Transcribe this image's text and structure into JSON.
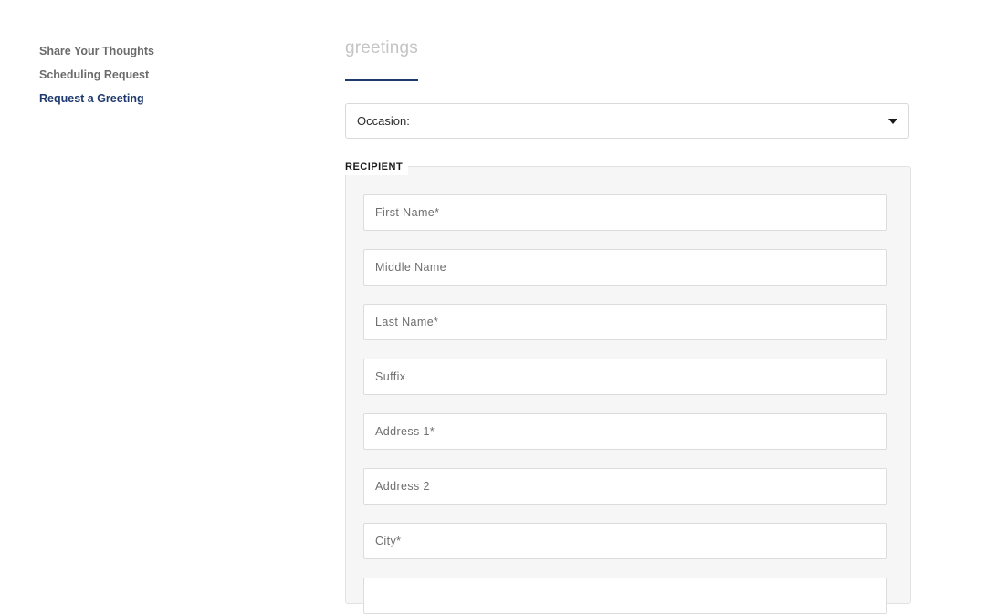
{
  "sidebar": {
    "items": [
      {
        "label": "Share Your Thoughts",
        "active": false
      },
      {
        "label": "Scheduling Request",
        "active": false
      },
      {
        "label": "Request a Greeting",
        "active": true
      }
    ]
  },
  "main": {
    "title": "greetings",
    "occasion": {
      "label": "Occasion:",
      "icon": "caret-down-icon"
    },
    "recipient": {
      "legend": "RECIPIENT",
      "fields": [
        {
          "placeholder": "First Name*",
          "value": ""
        },
        {
          "placeholder": "Middle Name",
          "value": ""
        },
        {
          "placeholder": "Last Name*",
          "value": ""
        },
        {
          "placeholder": "Suffix",
          "value": ""
        },
        {
          "placeholder": "Address 1*",
          "value": ""
        },
        {
          "placeholder": "Address 2",
          "value": ""
        },
        {
          "placeholder": "City*",
          "value": ""
        },
        {
          "placeholder": "",
          "value": ""
        }
      ]
    }
  },
  "colors": {
    "accent": "#1f3a6e",
    "sidebar_inactive": "#6b6b6b",
    "title": "#c4c4c4",
    "panel_bg": "#f6f6f6"
  }
}
